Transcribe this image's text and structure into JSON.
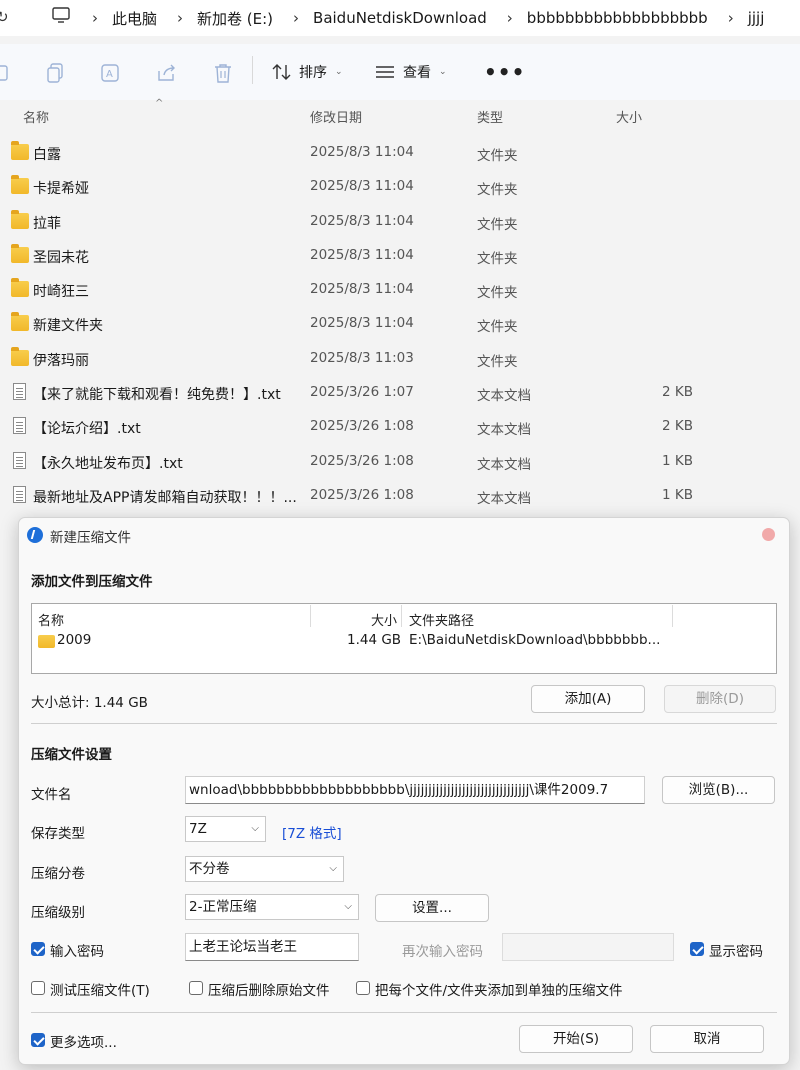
{
  "explorer": {
    "breadcrumb": [
      "此电脑",
      "新加卷 (E:)",
      "BaiduNetdiskDownload",
      "bbbbbbbbbbbbbbbbbbb",
      "jjjj"
    ],
    "toolbar": {
      "sort_label": "排序",
      "view_label": "查看",
      "more_label": "•••"
    },
    "columns": {
      "name": "名称",
      "date": "修改日期",
      "type": "类型",
      "size": "大小"
    },
    "files": [
      {
        "name": "白露",
        "date": "2025/8/3 11:04",
        "type": "文件夹",
        "size": "",
        "kind": "folder"
      },
      {
        "name": "卡提希娅",
        "date": "2025/8/3 11:04",
        "type": "文件夹",
        "size": "",
        "kind": "folder"
      },
      {
        "name": "拉菲",
        "date": "2025/8/3 11:04",
        "type": "文件夹",
        "size": "",
        "kind": "folder"
      },
      {
        "name": "圣园未花",
        "date": "2025/8/3 11:04",
        "type": "文件夹",
        "size": "",
        "kind": "folder"
      },
      {
        "name": "时崎狂三",
        "date": "2025/8/3 11:04",
        "type": "文件夹",
        "size": "",
        "kind": "folder"
      },
      {
        "name": "新建文件夹",
        "date": "2025/8/3 11:04",
        "type": "文件夹",
        "size": "",
        "kind": "folder"
      },
      {
        "name": "伊落玛丽",
        "date": "2025/8/3 11:03",
        "type": "文件夹",
        "size": "",
        "kind": "folder"
      },
      {
        "name": "【来了就能下载和观看！纯免费！】.txt",
        "date": "2025/3/26 1:07",
        "type": "文本文档",
        "size": "2 KB",
        "kind": "doc"
      },
      {
        "name": "【论坛介绍】.txt",
        "date": "2025/3/26 1:08",
        "type": "文本文档",
        "size": "2 KB",
        "kind": "doc"
      },
      {
        "name": "【永久地址发布页】.txt",
        "date": "2025/3/26 1:08",
        "type": "文本文档",
        "size": "1 KB",
        "kind": "doc"
      },
      {
        "name": "最新地址及APP请发邮箱自动获取！！！...",
        "date": "2025/3/26 1:08",
        "type": "文本文档",
        "size": "1 KB",
        "kind": "doc"
      }
    ]
  },
  "dialog": {
    "title": "新建压缩文件",
    "add_section": "添加文件到压缩文件",
    "list_headers": {
      "name": "名称",
      "size": "大小",
      "path": "文件夹路径"
    },
    "list_items": [
      {
        "name": "2009",
        "size": "1.44 GB",
        "path": "E:\\BaiduNetdiskDownload\\bbbbbbb..."
      }
    ],
    "total_size": "大小总计: 1.44 GB",
    "add_button": "添加(A)",
    "delete_button": "删除(D)",
    "settings_section": "压缩文件设置",
    "filename_label": "文件名",
    "filename_value": "wnload\\bbbbbbbbbbbbbbbbbbb\\jjjjjjjjjjjjjjjjjjjjjjjjjjjjjjjj\\课件2009.7",
    "browse_button": "浏览(B)...",
    "save_type_label": "保存类型",
    "save_type_value": "7Z",
    "format_link": "[7Z 格式]",
    "split_label": "压缩分卷",
    "split_value": "不分卷",
    "level_label": "压缩级别",
    "level_value": "2-正常压缩",
    "settings_button": "设置...",
    "password_check_label": "输入密码",
    "password_value": "上老王论坛当老王",
    "reenter_label": "再次输入密码",
    "show_password_label": "显示密码",
    "test_label": "测试压缩文件(T)",
    "delete_after_label": "压缩后删除原始文件",
    "separate_label": "把每个文件/文件夹添加到单独的压缩文件",
    "more_options_label": "更多选项...",
    "start_button": "开始(S)",
    "cancel_button": "取消"
  }
}
